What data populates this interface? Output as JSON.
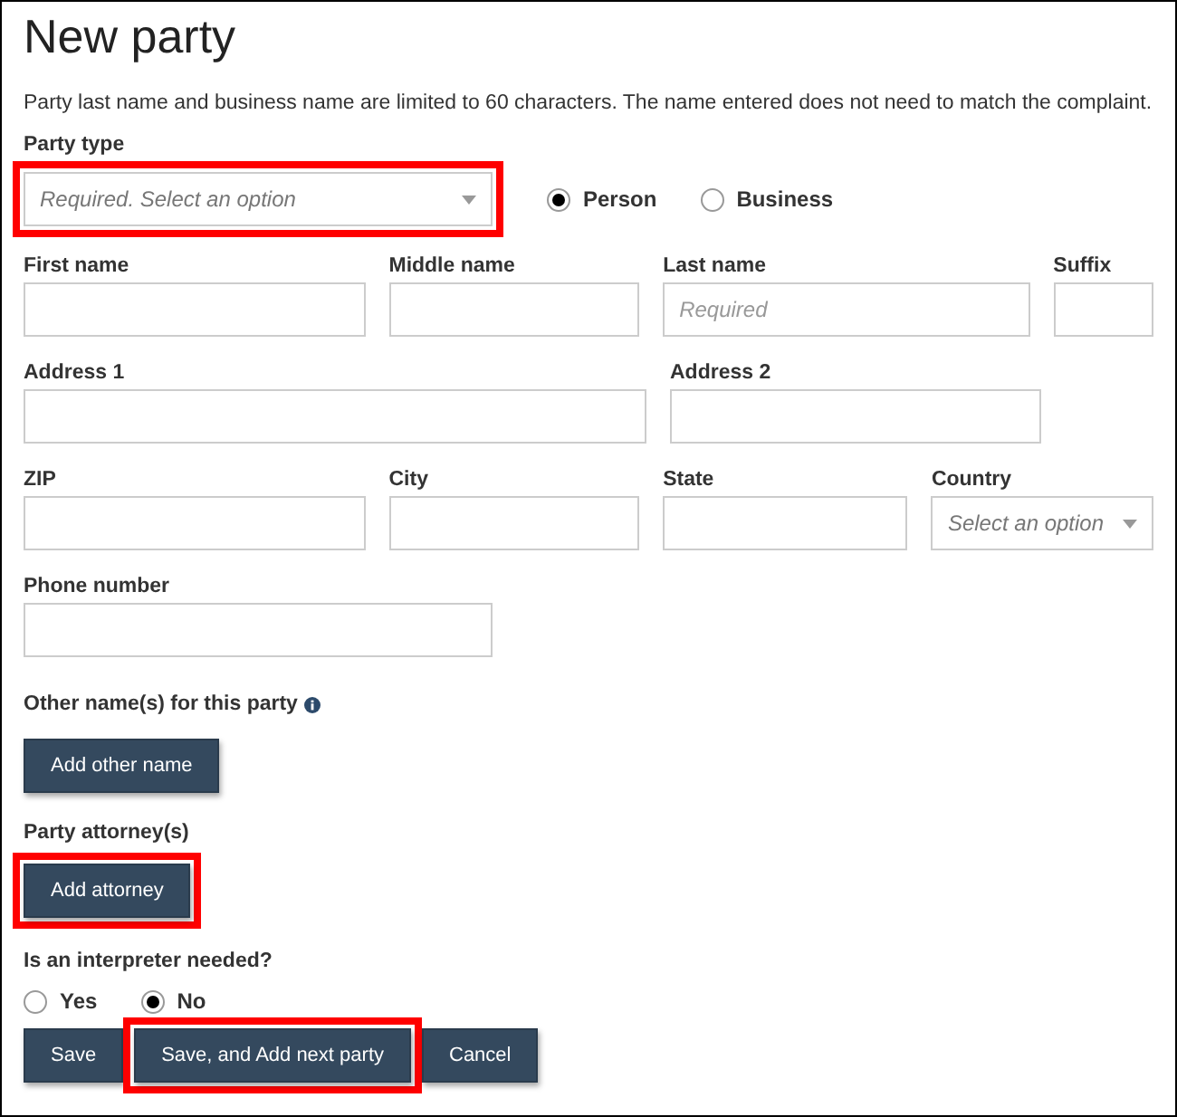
{
  "title": "New party",
  "description": "Party last name and business name are limited to 60 characters. The name entered does not need to match the complaint.",
  "party_type": {
    "label": "Party type",
    "placeholder": "Required. Select an option",
    "highlighted": true,
    "options": [
      {
        "label": "Person",
        "selected": true
      },
      {
        "label": "Business",
        "selected": false
      }
    ]
  },
  "field_rows": [
    [
      {
        "label": "First name",
        "kind": "text"
      },
      {
        "label": "Middle name",
        "kind": "text"
      },
      {
        "label": "Last name",
        "kind": "text",
        "placeholder": "Required"
      },
      {
        "label": "Suffix",
        "kind": "text"
      }
    ],
    [
      {
        "label": "Address 1",
        "kind": "text"
      },
      {
        "label": "Address 2",
        "kind": "text"
      }
    ],
    [
      {
        "label": "ZIP",
        "kind": "text"
      },
      {
        "label": "City",
        "kind": "text"
      },
      {
        "label": "State",
        "kind": "text"
      },
      {
        "label": "Country",
        "kind": "select",
        "placeholder": "Select an option"
      }
    ],
    [
      {
        "label": "Phone number",
        "kind": "text"
      }
    ]
  ],
  "other_names": {
    "label": "Other name(s) for this party",
    "button": {
      "label": "Add other name",
      "highlighted": false
    }
  },
  "attorneys": {
    "label": "Party attorney(s)",
    "button": {
      "label": "Add attorney",
      "highlighted": true
    }
  },
  "interpreter": {
    "label": "Is an interpreter needed?",
    "options": [
      {
        "label": "Yes",
        "selected": false
      },
      {
        "label": "No",
        "selected": true
      }
    ]
  },
  "actions": [
    {
      "label": "Save",
      "highlighted": false
    },
    {
      "label": "Save, and Add next party",
      "highlighted": true
    },
    {
      "label": "Cancel",
      "highlighted": false
    }
  ]
}
